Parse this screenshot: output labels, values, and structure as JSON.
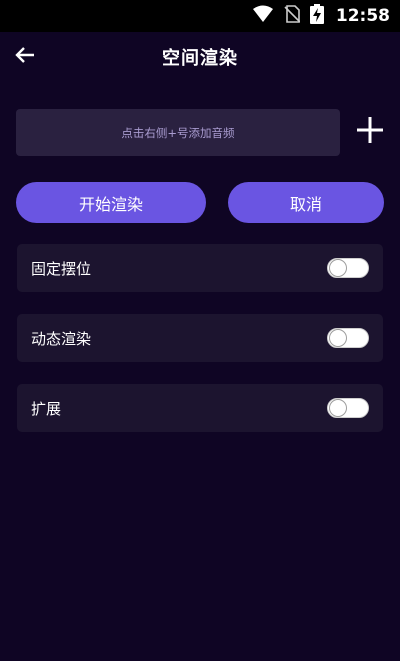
{
  "status_bar": {
    "time": "12:58",
    "icons": [
      "wifi-icon",
      "no-sim-icon",
      "battery-charging-icon"
    ]
  },
  "header": {
    "title": "空间渲染",
    "back_icon": "arrow-left-icon"
  },
  "audio": {
    "hint": "点击右侧+号添加音频",
    "add_icon": "plus-icon"
  },
  "actions": {
    "start_label": "开始渲染",
    "cancel_label": "取消"
  },
  "settings": [
    {
      "label": "固定摆位",
      "enabled": false
    },
    {
      "label": "动态渲染",
      "enabled": false
    },
    {
      "label": "扩展",
      "enabled": false
    }
  ],
  "colors": {
    "background": "#0f0524",
    "card": "#1c142f",
    "input": "#2a2140",
    "accent": "#6a55e2",
    "hint_text": "#a99cd0"
  }
}
